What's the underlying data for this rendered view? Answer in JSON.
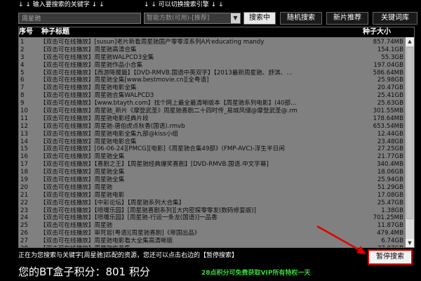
{
  "hints": {
    "left": "↓ ↓ 输入要搜索的关键字 ↓ ↓",
    "right": "↓ ↓ 可以切换搜索引擎 ↓ ↓"
  },
  "search": {
    "value": "周星驰",
    "engine": "智能方数(可用)-[推荐]"
  },
  "buttons": {
    "searching": "搜索中",
    "random": "随机搜索",
    "new": "新片推荐",
    "keywords": "关键词库"
  },
  "table": {
    "headers": {
      "index": "序号",
      "title": "种子标题",
      "size": "种子大小"
    },
    "rows": [
      {
        "index": "1",
        "title": "【双击可在线播放】[susun]老片新看周星驰国产零零漆系列A片educating mandy",
        "size": "857.74MB"
      },
      {
        "index": "2",
        "title": "【双击可在线播放】周星驰高清合集",
        "size": "154.1GB"
      },
      {
        "index": "3",
        "title": "【双击可在线播放】周星驰WALPCD3全集",
        "size": "55.3GB"
      },
      {
        "index": "4",
        "title": "【双击可在线播放】周星驰作品小合集",
        "size": "197.04GB"
      },
      {
        "index": "5",
        "title": "【双击可在线播放】【西游降魔篇】【DVD-RMVB.国语中英双字】【2013最新周星驰、舒淇、...",
        "size": "586.64MB"
      },
      {
        "index": "6",
        "title": "【双击可在线播放】周星驰全集[www.bestmovie.cn][全粤语]",
        "size": "25.98GB"
      },
      {
        "index": "7",
        "title": "【双击可在线播放】周星驰电影全集",
        "size": "20.47GB"
      },
      {
        "index": "8",
        "title": "【双击可在线播放】周星驰合集WALPCD3",
        "size": "25.41GB"
      },
      {
        "index": "9",
        "title": "【双击可在线播放】【www.btayth.com】找个网上最全最清晰版本【周星驰系列电影】(40部...",
        "size": "25.63GB"
      },
      {
        "index": "10",
        "title": "【双击可在线播放】周星驰_新片《摩登武圣》周星驰喜剧二十四时传_易城凤储@摩登武圣@.rm",
        "size": "301.55MB"
      },
      {
        "index": "11",
        "title": "【双击可在线播放】周星驰电影经典片段",
        "size": "178.64MB"
      },
      {
        "index": "12",
        "title": "【双击可在线播放】周星驰-唐伯虎点秋香(国语).rmvb",
        "size": "653.54MB"
      },
      {
        "index": "13",
        "title": "【双击可在线播放】周星驰电影全集九部@kiss小组",
        "size": "12.44GB"
      },
      {
        "index": "14",
        "title": "【双击可在线播放】周星驰电影合集",
        "size": "23.48GB"
      },
      {
        "index": "15",
        "title": "【双击可在线播放】[06-06-24][PMCG][电影]《周星驰合集49部》(FMP-AVC)-浮生半日闲",
        "size": "27.25GB"
      },
      {
        "index": "16",
        "title": "【双击可在线播放】周星驰全集",
        "size": "21.77GB"
      },
      {
        "index": "17",
        "title": "【双击可在线播放】【喜剧之王】【周星驰经典爆笑喜剧】[DVD-RMVB.国语.中文字幕]",
        "size": "340.4MB"
      },
      {
        "index": "18",
        "title": "【双击可在线播放】周星驰全集",
        "size": "18.06GB"
      },
      {
        "index": "19",
        "title": "【双击可在线播放】周星驰全集",
        "size": "25.94GB"
      },
      {
        "index": "20",
        "title": "【双击可在线播放】周星驰",
        "size": "51.29GB"
      },
      {
        "index": "21",
        "title": "【双击可在线播放】周星驰电影",
        "size": "17.08GB"
      },
      {
        "index": "22",
        "title": "【双击可在线播放】【中彩论坛】【周星驰系列大合集】",
        "size": "25.47GB"
      },
      {
        "index": "23",
        "title": "【双击可在线播放】【喷嚏乐园】[周星驰喜剧系列][大内密探零零发(数码修复版)]",
        "size": "1.38GB"
      },
      {
        "index": "24",
        "title": "【双击可在线播放】【喷嚏乐园】[周星驰-行运一条龙(国语)]一品香",
        "size": "701.25MB"
      },
      {
        "index": "25",
        "title": "【双击可在线播放】周星驰",
        "size": "11.87GB"
      },
      {
        "index": "26",
        "title": "【双击可在线播放】审死官(粤语)[周星驰喜剧]《帝国出品》",
        "size": "479.4MB"
      },
      {
        "index": "27",
        "title": "【双击可在线播放】周星驰电影看大全集高清晰版",
        "size": "6.74GB"
      },
      {
        "index": "28",
        "title": "【双击可在线播放】周星驰作品集",
        "size": "37.87GB"
      }
    ]
  },
  "status": {
    "message": "正在为您搜索与关键字[周星驰]匹配的资源，您还可以点击右边的【暂停搜索】",
    "pause_button": "暂停搜索"
  },
  "footer": {
    "points_label": "您的BT盒子积分：801 积分",
    "vip_promo": "28点积分可免费获取VIP所有特权一天"
  },
  "colors": {
    "table_bg": "#808080",
    "highlight_border": "#e00000",
    "promo_green": "#3ad43a"
  }
}
